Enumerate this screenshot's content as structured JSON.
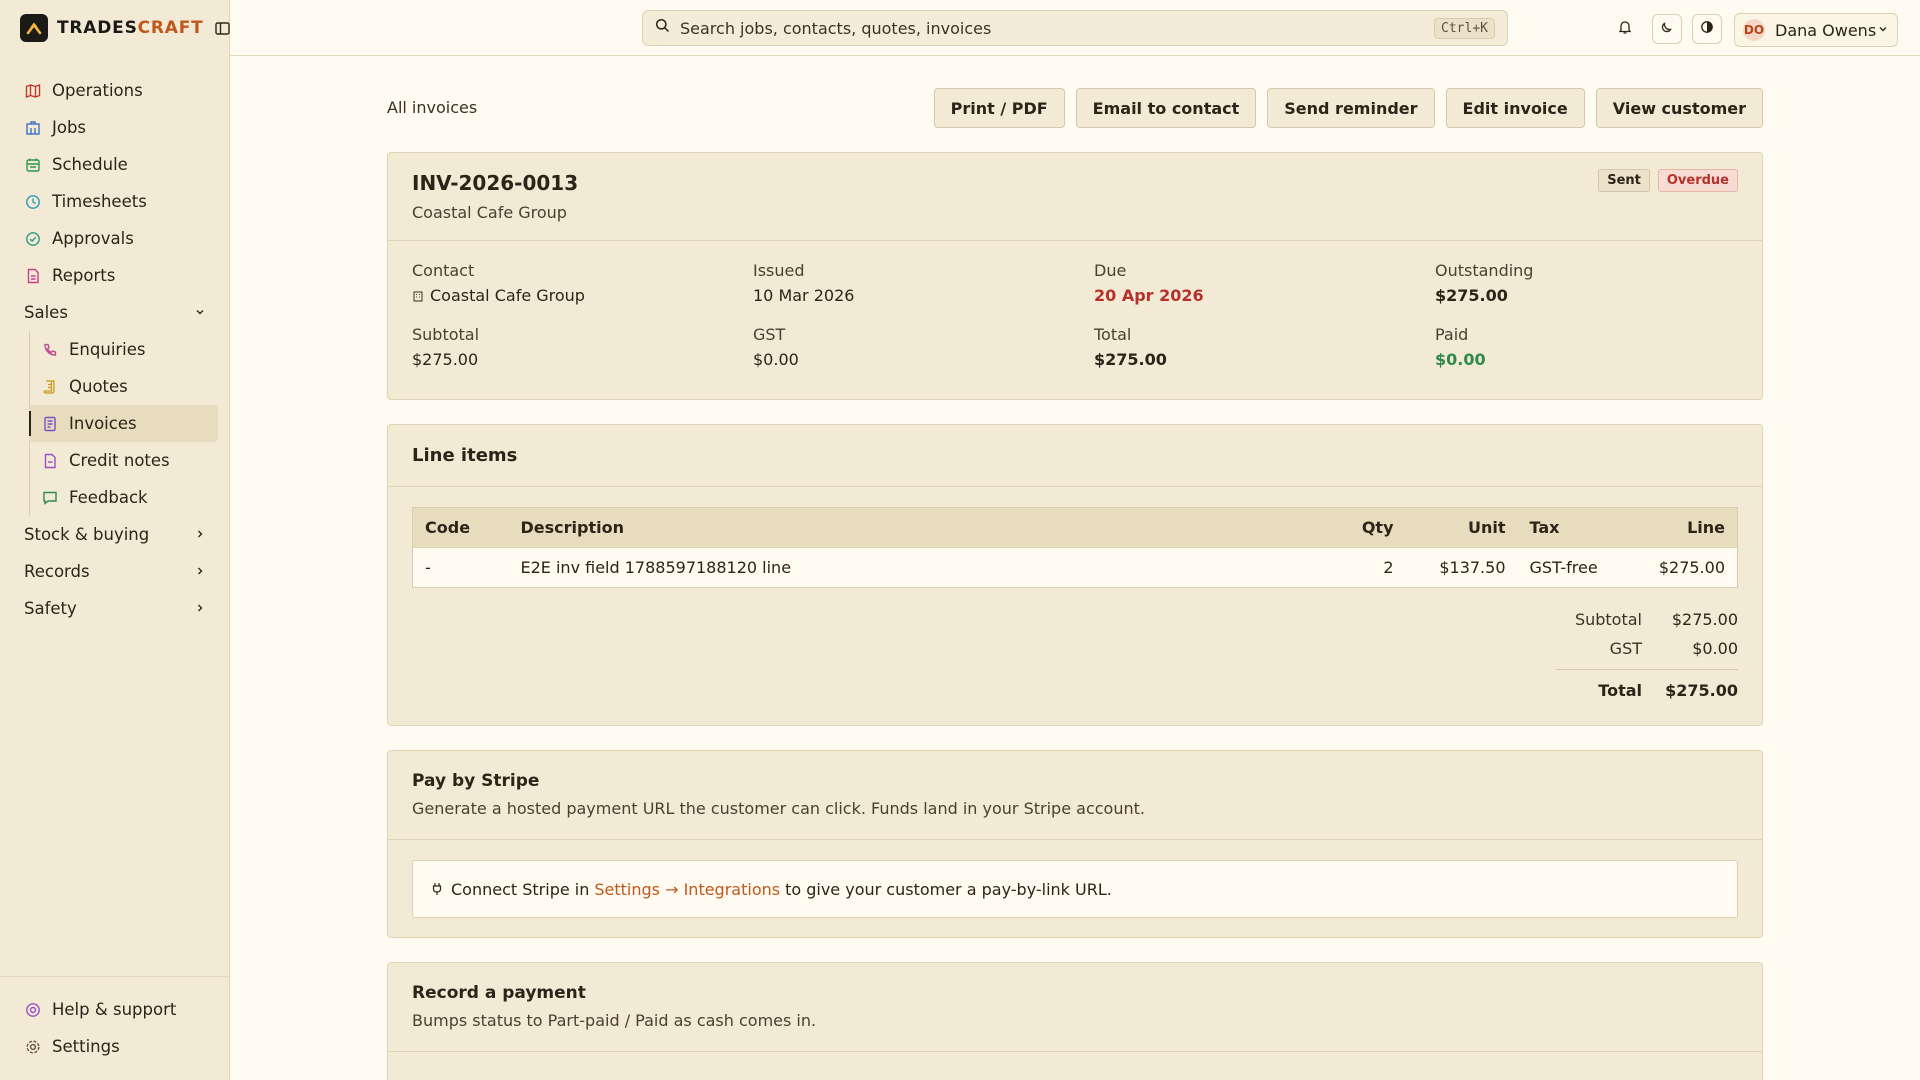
{
  "brand": {
    "name_part1": "TRADES",
    "name_part2": "CRAFT"
  },
  "sidebar": {
    "items": [
      {
        "label": "Operations",
        "icon": "map-icon"
      },
      {
        "label": "Jobs",
        "icon": "building-icon"
      },
      {
        "label": "Schedule",
        "icon": "calendar-icon"
      },
      {
        "label": "Timesheets",
        "icon": "clock-icon"
      },
      {
        "label": "Approvals",
        "icon": "check-circle-icon"
      },
      {
        "label": "Reports",
        "icon": "report-icon"
      }
    ],
    "sales_group": "Sales",
    "sales_items": [
      {
        "label": "Enquiries",
        "icon": "phone-icon"
      },
      {
        "label": "Quotes",
        "icon": "scroll-icon"
      },
      {
        "label": "Invoices",
        "icon": "invoice-icon"
      },
      {
        "label": "Credit notes",
        "icon": "document-icon"
      },
      {
        "label": "Feedback",
        "icon": "chat-icon"
      }
    ],
    "groups": [
      "Stock & buying",
      "Records",
      "Safety"
    ],
    "bottom": [
      {
        "label": "Help & support",
        "icon": "lifebuoy-icon"
      },
      {
        "label": "Settings",
        "icon": "gear-icon"
      }
    ]
  },
  "topbar": {
    "search_placeholder": "Search jobs, contacts, quotes, invoices",
    "shortcut": "Ctrl+K",
    "user_initials": "DO",
    "user_name": "Dana Owens"
  },
  "toolbar": {
    "back": "All invoices",
    "actions": [
      "Print / PDF",
      "Email to contact",
      "Send reminder",
      "Edit invoice",
      "View customer"
    ]
  },
  "invoice": {
    "number": "INV-2026-0013",
    "customer": "Coastal Cafe Group",
    "status_sent": "Sent",
    "status_overdue": "Overdue",
    "fields": {
      "contact_label": "Contact",
      "contact": "Coastal Cafe Group",
      "issued_label": "Issued",
      "issued": "10 Mar 2026",
      "due_label": "Due",
      "due": "20 Apr 2026",
      "outstanding_label": "Outstanding",
      "outstanding": "$275.00",
      "subtotal_label": "Subtotal",
      "subtotal": "$275.00",
      "gst_label": "GST",
      "gst": "$0.00",
      "total_label": "Total",
      "total": "$275.00",
      "paid_label": "Paid",
      "paid": "$0.00"
    }
  },
  "line_items": {
    "title": "Line items",
    "columns": {
      "code": "Code",
      "description": "Description",
      "qty": "Qty",
      "unit": "Unit",
      "tax": "Tax",
      "line": "Line"
    },
    "rows": [
      {
        "code": "-",
        "description": "E2E inv field 1788597188120 line",
        "qty": "2",
        "unit": "$137.50",
        "tax": "GST-free",
        "line": "$275.00"
      }
    ],
    "totals": {
      "subtotal_label": "Subtotal",
      "subtotal": "$275.00",
      "gst_label": "GST",
      "gst": "$0.00",
      "total_label": "Total",
      "total": "$275.00"
    }
  },
  "stripe": {
    "title": "Pay by Stripe",
    "subtitle": "Generate a hosted payment URL the customer can click. Funds land in your Stripe account.",
    "msg_before": "Connect Stripe in",
    "msg_link": "Settings → Integrations",
    "msg_after": "to give your customer a pay-by-link URL."
  },
  "payment": {
    "title": "Record a payment",
    "subtitle": "Bumps status to Part-paid / Paid as cash comes in."
  },
  "colors": {
    "accent": "#c0581e",
    "overdue": "#b5322c",
    "paid": "#2f8a4a",
    "sidebar_bg": "#f3ead6"
  }
}
